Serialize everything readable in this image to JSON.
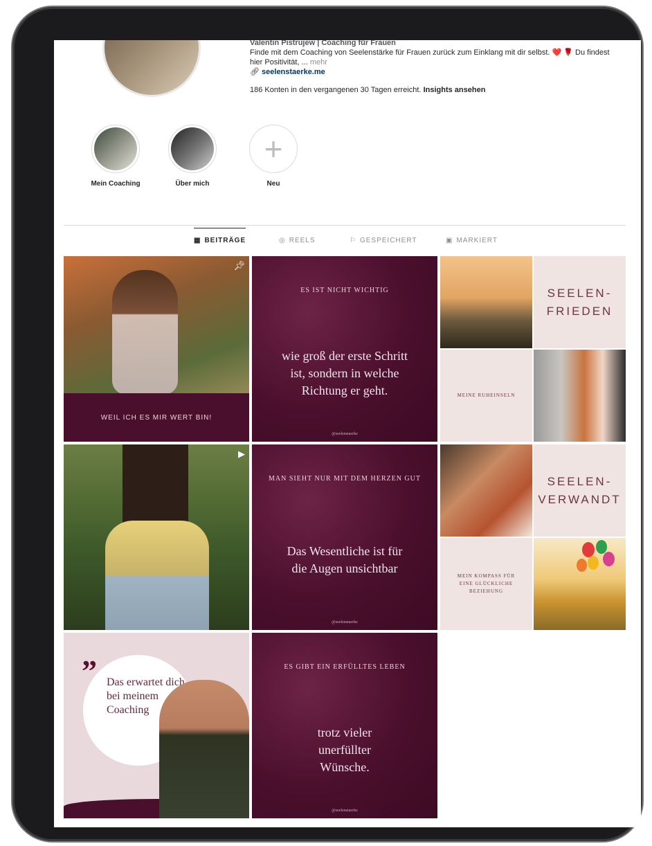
{
  "profile": {
    "name": "Valentin Pistrujew | Coaching für Frauen",
    "bio": "Finde mit dem Coaching von Seelenstärke für Frauen zurück zum Einklang mit dir selbst. ❤️ 🌹 Du findest hier Positivität, ...",
    "more": "mehr",
    "link": "seelenstaerke.me",
    "reach_text": "186 Konten in den vergangenen 30 Tagen erreicht.",
    "insights_link": "Insights ansehen"
  },
  "highlights": [
    {
      "label": "Mein Coaching"
    },
    {
      "label": "Über mich"
    },
    {
      "label": "Neu"
    }
  ],
  "tabs": [
    {
      "label": "BEITRÄGE",
      "icon": "grid-icon",
      "active": true
    },
    {
      "label": "REELS",
      "icon": "reels-icon",
      "active": false
    },
    {
      "label": "GESPEICHERT",
      "icon": "bookmark-icon",
      "active": false
    },
    {
      "label": "MARKIERT",
      "icon": "tag-icon",
      "active": false
    }
  ],
  "posts": {
    "p1_banner": "WEIL ICH ES MIR WERT BIN!",
    "p2_arc": "ES IST NICHT WICHTIG",
    "p2_quote": "wie groß der erste Schritt ist, sondern in welche Richtung er geht.",
    "p2_handle": "@seelenstaerke",
    "p3_title": "SEELEN-\nFRIEDEN",
    "p3_sub": "MEINE RUHEINSELN",
    "p5_arc": "MAN SIEHT NUR MIT DEM HERZEN GUT",
    "p5_quote": "Das Wesentliche ist für die Augen unsichtbar",
    "p5_handle": "@seelenstaerke",
    "p6_title": "SEELEN-\nVERWANDT",
    "p6_sub": "MEIN KOMPASS FÜR EINE GLÜCKLICHE BEZIEHUNG",
    "p7_text": "Das erwartet dich bei meinem Coaching",
    "p8_arc": "ES GIBT EIN ERFÜLLTES LEBEN",
    "p8_quote": "trotz vieler unerfüllter Wünsche.",
    "p8_handle": "@seelenstaerke"
  },
  "colors": {
    "plum": "#4a0f2c",
    "beige": "#efe4e1",
    "accent_text": "#6b3447"
  }
}
